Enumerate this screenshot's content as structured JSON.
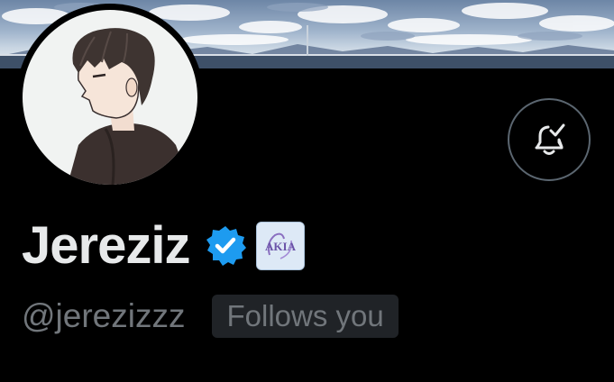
{
  "profile": {
    "display_name": "Jereziz",
    "handle": "@jerezizzz",
    "follows_you_label": "Follows you",
    "affiliate_badge_text": "AKIA"
  },
  "icons": {
    "bell": "bell-check-icon",
    "verified": "verified-badge-icon",
    "affiliate": "affiliate-badge-icon"
  },
  "colors": {
    "background": "#000000",
    "name_text": "#e7e9ea",
    "secondary_text": "#71767b",
    "verified_blue": "#1d9bf0",
    "badge_background": "#202327",
    "button_border": "#5b6670"
  }
}
